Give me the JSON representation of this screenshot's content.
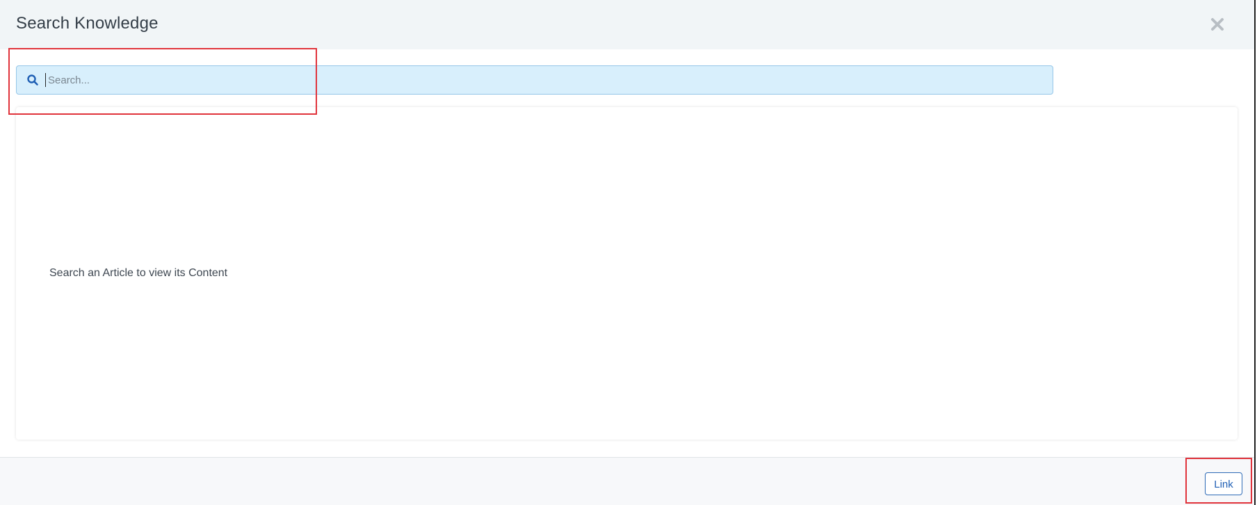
{
  "modal": {
    "title": "Search Knowledge",
    "close_icon": "close-icon"
  },
  "search": {
    "icon": "search-icon",
    "placeholder": "Search...",
    "value": ""
  },
  "content": {
    "empty_message": "Search an Article to view its Content"
  },
  "footer": {
    "link_label": "Link"
  },
  "colors": {
    "header_bg": "#f1f5f7",
    "search_bg": "#d8effc",
    "accent": "#1f5fb4",
    "highlight": "#e0323a"
  }
}
